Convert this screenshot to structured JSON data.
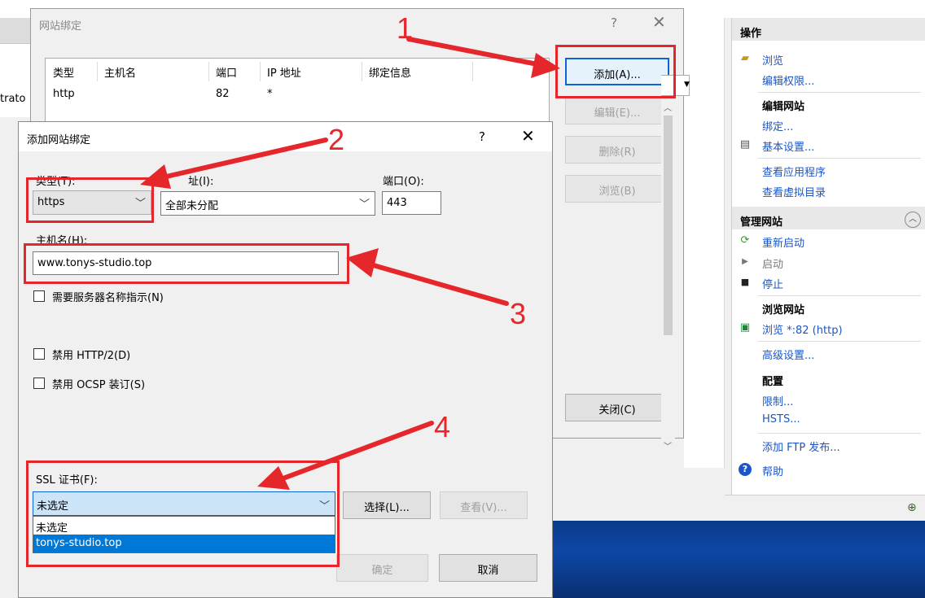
{
  "background": {
    "partial_text": "trato",
    "tray_icon": "network-tray-icon"
  },
  "actions_panel": {
    "header": "操作",
    "browse": "浏览",
    "edit_permissions": "编辑权限...",
    "edit_site_header": "编辑网站",
    "bindings": "绑定...",
    "basic_settings": "基本设置...",
    "view_applications": "查看应用程序",
    "view_virtual_dirs": "查看虚拟目录",
    "manage_site_header": "管理网站",
    "restart": "重新启动",
    "start": "启动",
    "stop": "停止",
    "browse_site_header": "浏览网站",
    "browse_port": "浏览 *:82 (http)",
    "advanced_settings": "高级设置...",
    "config_header": "配置",
    "limits": "限制...",
    "hsts": "HSTS...",
    "add_ftp": "添加 FTP 发布...",
    "help": "帮助",
    "collapse_glyph": "︿"
  },
  "site_bindings": {
    "title": "网站绑定",
    "help": "?",
    "close": "✕",
    "columns": [
      "类型",
      "主机名",
      "端口",
      "IP 地址",
      "绑定信息"
    ],
    "rows": [
      {
        "type": "http",
        "host": "",
        "port": "82",
        "ip": "*",
        "info": ""
      }
    ],
    "add_button": "添加(A)...",
    "edit_button": "编辑(E)...",
    "remove_button": "删除(R)",
    "browse_button": "浏览(B)",
    "close_button": "关闭(C)"
  },
  "add_binding": {
    "title": "添加网站绑定",
    "help": "?",
    "close": "✕",
    "type_label": "类型(T):",
    "type_value": "https",
    "ip_label": "IP 地址(I):",
    "ip_label_visible": "址(I):",
    "ip_value": "全部未分配",
    "port_label": "端口(O):",
    "port_value": "443",
    "host_label": "主机名(H):",
    "host_value": "www.tonys-studio.top",
    "sni_label": "需要服务器名称指示(N)",
    "disable_http2_label": "禁用 HTTP/2(D)",
    "disable_ocsp_label": "禁用 OCSP 装订(S)",
    "ssl_label": "SSL 证书(F):",
    "ssl_selected": "未选定",
    "ssl_options": [
      "未选定",
      "tonys-studio.top"
    ],
    "select_button": "选择(L)...",
    "view_button": "查看(V)...",
    "ok_button": "确定",
    "cancel_button": "取消"
  },
  "annotations": {
    "colors": {
      "red": "#e5262b"
    },
    "labels": [
      "1",
      "2",
      "3",
      "4"
    ]
  }
}
